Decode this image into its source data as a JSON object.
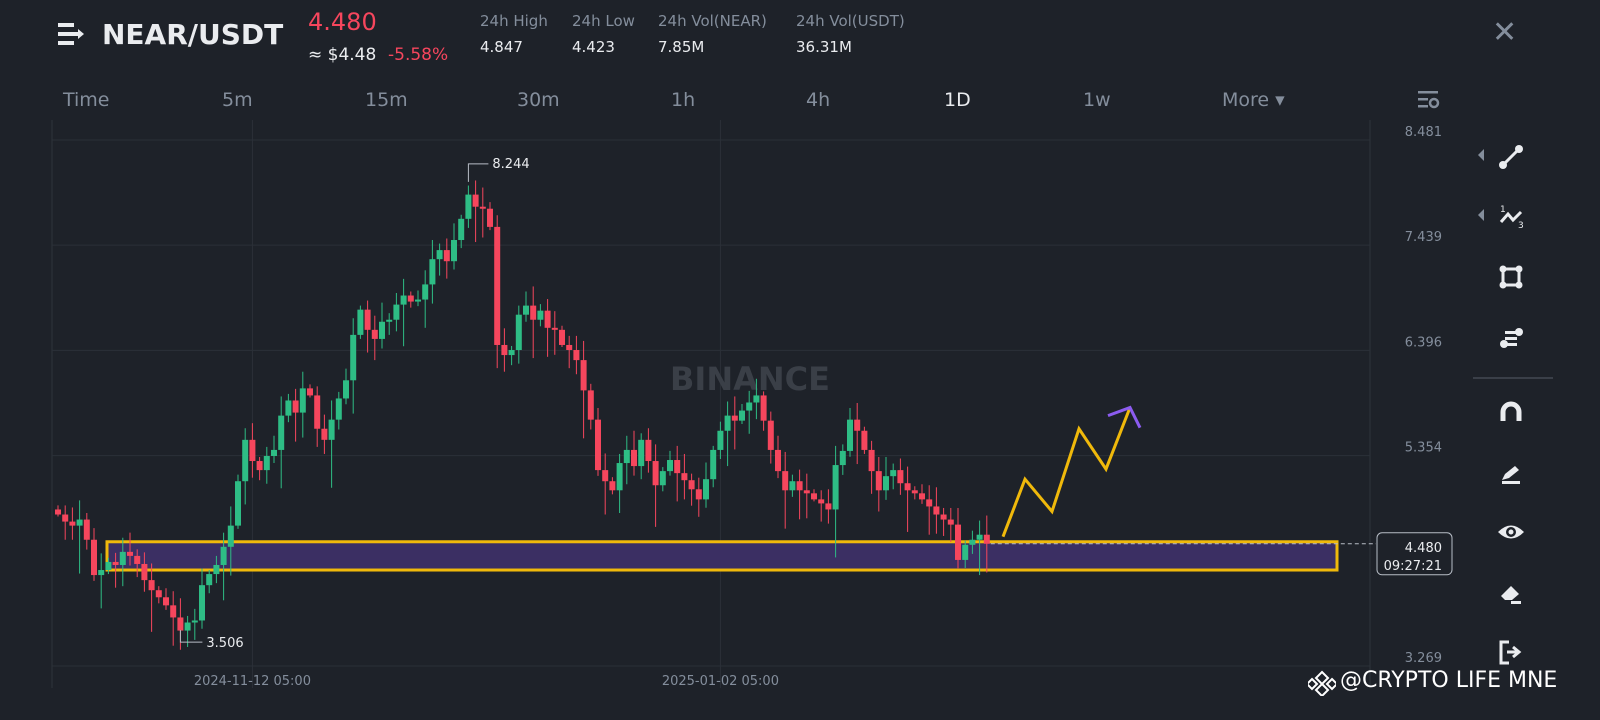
{
  "header": {
    "pair": "NEAR/USDT",
    "last_price": "4.480",
    "usd_price": "≈ $4.48",
    "change": "-5.58%",
    "stats": [
      {
        "label": "24h High",
        "value": "4.847"
      },
      {
        "label": "24h Low",
        "value": "4.423"
      },
      {
        "label": "24h Vol(NEAR)",
        "value": "7.85M"
      },
      {
        "label": "24h Vol(USDT)",
        "value": "36.31M"
      }
    ]
  },
  "timeframes": [
    "Time",
    "5m",
    "15m",
    "30m",
    "1h",
    "4h",
    "1D",
    "1w"
  ],
  "active_timeframe": "1D",
  "more_label": "More ▾",
  "watermark": "BINANCE",
  "credit": "@CRYPTO LIFE MNE",
  "colors": {
    "up": "#2ebd85",
    "down": "#f6465d",
    "zone_border": "#f0b90b",
    "zone_fill": "#3b2f63",
    "projection": "#f0b90b",
    "projection_end": "#8c5cf0"
  },
  "chart_data": {
    "type": "candlestick",
    "ylim": [
      3.269,
      8.481
    ],
    "y_ticks": [
      "8.481",
      "7.439",
      "6.396",
      "5.354",
      "3.269"
    ],
    "x_ticks": [
      {
        "label": "2024-11-12 05:00",
        "index": 27
      },
      {
        "label": "2025-01-02 05:00",
        "index": 92
      }
    ],
    "closes": [
      4.77,
      4.7,
      4.66,
      4.72,
      4.52,
      4.17,
      4.22,
      4.3,
      4.27,
      4.4,
      4.36,
      4.28,
      4.12,
      4.02,
      3.95,
      3.87,
      3.75,
      3.62,
      3.7,
      3.72,
      4.07,
      4.18,
      4.27,
      4.45,
      4.66,
      5.1,
      5.51,
      5.3,
      5.21,
      5.35,
      5.41,
      5.75,
      5.9,
      5.78,
      6.02,
      5.95,
      5.62,
      5.51,
      5.71,
      5.92,
      6.1,
      6.55,
      6.8,
      6.6,
      6.51,
      6.68,
      6.7,
      6.85,
      6.94,
      6.88,
      6.9,
      7.05,
      7.3,
      7.39,
      7.28,
      7.49,
      7.7,
      7.94,
      7.82,
      7.8,
      7.62,
      6.45,
      6.35,
      6.4,
      6.75,
      6.84,
      6.7,
      6.79,
      6.62,
      6.6,
      6.45,
      6.4,
      6.3,
      6.0,
      5.71,
      5.21,
      5.1,
      5.01,
      5.28,
      5.41,
      5.25,
      5.51,
      5.3,
      5.06,
      5.2,
      5.31,
      5.18,
      5.11,
      5.02,
      4.92,
      5.12,
      5.41,
      5.6,
      5.75,
      5.7,
      5.8,
      5.88,
      5.95,
      5.7,
      5.41,
      5.2,
      5.01,
      5.1,
      5.01,
      4.98,
      4.92,
      4.88,
      4.82,
      5.26,
      5.4,
      5.71,
      5.6,
      5.41,
      5.2,
      5.01,
      5.15,
      5.21,
      5.08,
      5.01,
      4.98,
      4.92,
      4.85,
      4.77,
      4.72,
      4.67,
      4.32,
      4.47,
      4.52,
      4.57,
      4.48
    ],
    "high_label": {
      "value": "8.244",
      "index": 57
    },
    "low_label": {
      "value": "3.506",
      "index": 17
    },
    "current_price": "4.480",
    "countdown": "09:27:21",
    "support_zone": [
      4.22,
      4.5
    ],
    "projection": [
      4.55,
      5.12,
      4.8,
      5.62,
      5.22,
      5.83
    ],
    "projection_end": [
      5.75,
      5.83,
      5.63
    ]
  }
}
